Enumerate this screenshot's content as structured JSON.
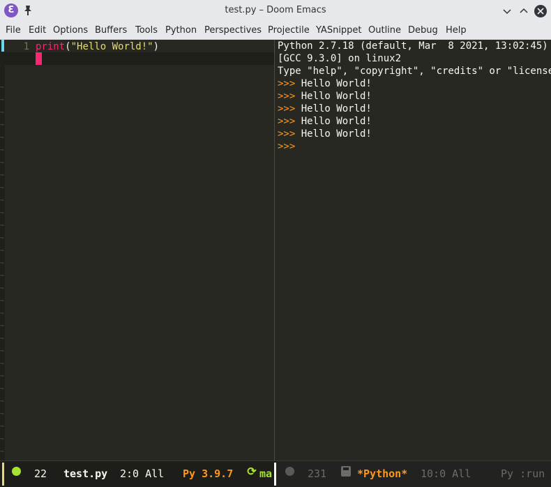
{
  "window": {
    "title": "test.py – Doom Emacs",
    "app_icon": "emacs-icon",
    "app_icon_glyph": "Ɛ",
    "pin_icon": "pin-icon",
    "pin_glyph": "📌",
    "minimize_glyph": "⌄",
    "maximize_glyph": "⌃",
    "close_glyph": "✕"
  },
  "menubar": {
    "items": [
      "File",
      "Edit",
      "Options",
      "Buffers",
      "Tools",
      "Python",
      "Perspectives",
      "Projectile",
      "YASnippet",
      "Outline",
      "Debug",
      "Help"
    ]
  },
  "editor": {
    "line_number": "1",
    "code": {
      "keyword": "print",
      "open_paren": "(",
      "string": "\"Hello World!\"",
      "close_paren": ")"
    },
    "fringe_marker": "~"
  },
  "repl": {
    "lines": [
      {
        "prompt": "",
        "text": "Python 2.7.18 (default, Mar  8 2021, 13:02:45)"
      },
      {
        "prompt": "",
        "text": "[GCC 9.3.0] on linux2"
      },
      {
        "prompt": "",
        "text": "Type \"help\", \"copyright\", \"credits\" or \"license\""
      },
      {
        "prompt": ">>> ",
        "text": "Hello World!"
      },
      {
        "prompt": ">>> ",
        "text": "Hello World!"
      },
      {
        "prompt": ">>> ",
        "text": "Hello World!"
      },
      {
        "prompt": ">>> ",
        "text": "Hello World!"
      },
      {
        "prompt": ">>> ",
        "text": "Hello World!"
      },
      {
        "prompt": ">>> ",
        "text": ""
      }
    ]
  },
  "modeline_left": {
    "line_count": "22",
    "buffer_name": "test.py",
    "position": "2:0 All",
    "python_version": "Py 3.9.7",
    "branch": "ma",
    "git_icon_glyph": "⟳"
  },
  "modeline_right": {
    "line_count": "231",
    "buffer_name": "*Python*",
    "position": "10:0 All",
    "mode": "Py :run"
  },
  "colors": {
    "background": "#272822",
    "keyword": "#f92672",
    "string": "#e6db74",
    "prompt": "#fd971f",
    "accent_green": "#a6e22e",
    "cursor": "#f92672"
  }
}
